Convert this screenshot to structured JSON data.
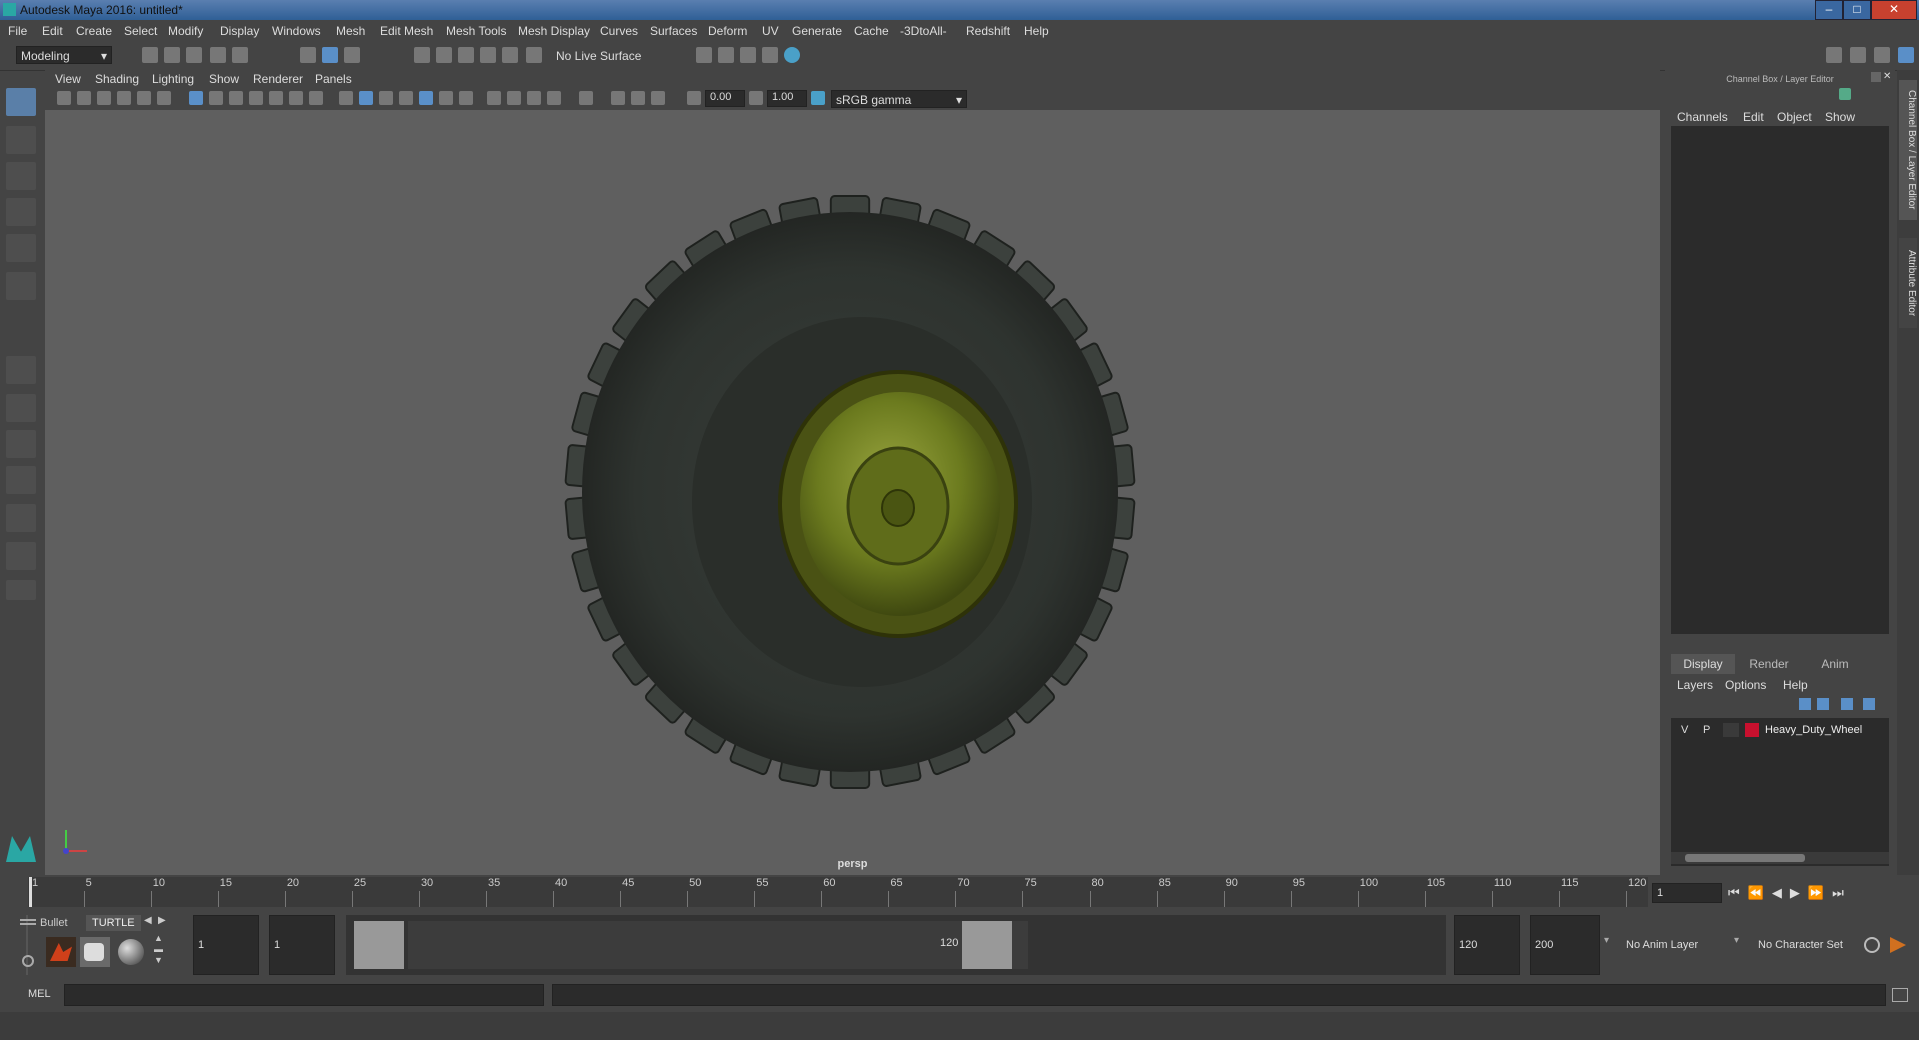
{
  "window": {
    "title": "Autodesk Maya 2016: untitled*"
  },
  "menu": [
    "File",
    "Edit",
    "Create",
    "Select",
    "Modify",
    "Display",
    "Windows",
    "Mesh",
    "Edit Mesh",
    "Mesh Tools",
    "Mesh Display",
    "Curves",
    "Surfaces",
    "Deform",
    "UV",
    "Generate",
    "Cache",
    "-3DtoAll-",
    "Redshift",
    "Help"
  ],
  "toolbar": {
    "mode": "Modeling",
    "live_surface": "No Live Surface"
  },
  "panel": {
    "menu": [
      "View",
      "Shading",
      "Lighting",
      "Show",
      "Renderer",
      "Panels"
    ],
    "exposure": "0.00",
    "gamma": "1.00",
    "color_space": "sRGB gamma",
    "camera_label": "persp"
  },
  "channel_box": {
    "header": "Channel Box / Layer Editor",
    "menu": [
      "Channels",
      "Edit",
      "Object",
      "Show"
    ],
    "side_tabs": [
      "Channel Box / Layer Editor",
      "Attribute Editor"
    ]
  },
  "layer_editor": {
    "tabs": [
      "Display",
      "Render",
      "Anim"
    ],
    "menu": [
      "Layers",
      "Options",
      "Help"
    ],
    "layers": [
      {
        "v": "V",
        "p": "P",
        "name": "Heavy_Duty_Wheel",
        "color": "#c8102e"
      }
    ]
  },
  "timeline": {
    "ticks": [
      "1",
      "5",
      "10",
      "15",
      "20",
      "25",
      "30",
      "35",
      "40",
      "45",
      "50",
      "55",
      "60",
      "65",
      "70",
      "75",
      "80",
      "85",
      "90",
      "95",
      "100",
      "105",
      "110",
      "115",
      "120"
    ],
    "current_frame": "1"
  },
  "range": {
    "shelf_tabs": [
      "Bullet",
      "TURTLE"
    ],
    "start": "1",
    "playback_start": "1",
    "slider_start": "1",
    "slider_end": "120",
    "playback_end": "120",
    "end": "200",
    "anim_layer": "No Anim Layer",
    "character_set": "No Character Set"
  },
  "command": {
    "label": "MEL"
  }
}
